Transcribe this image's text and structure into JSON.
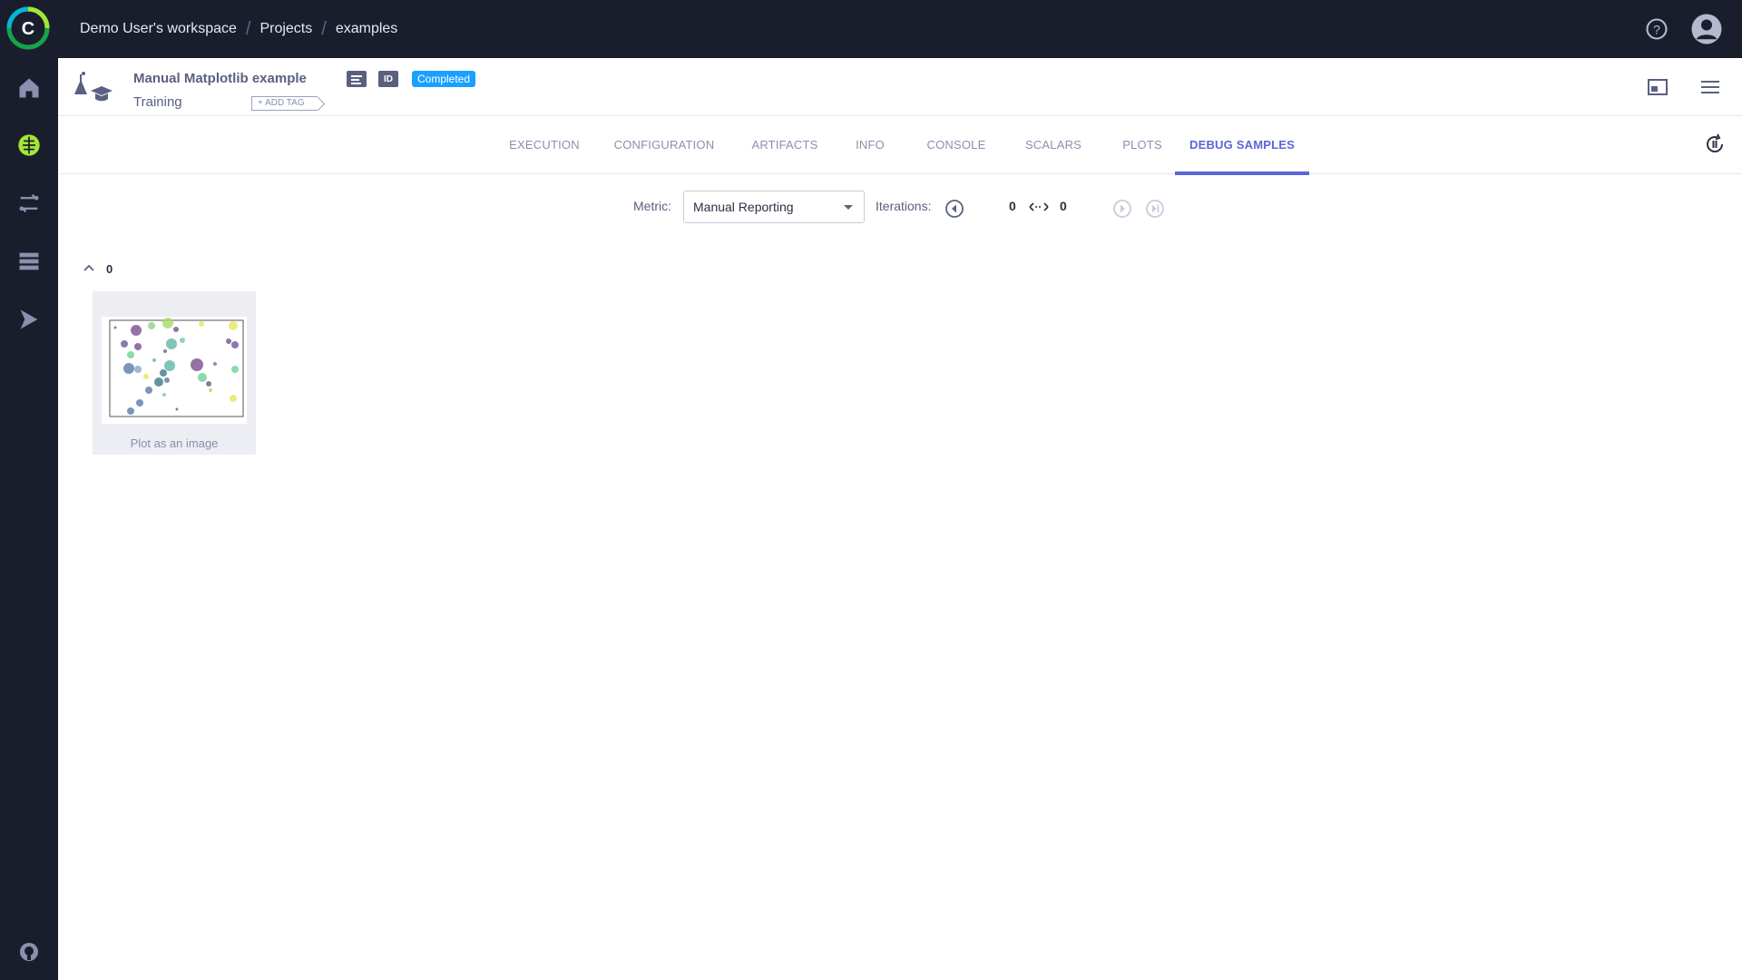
{
  "breadcrumb": {
    "workspace": "Demo User's workspace",
    "projects": "Projects",
    "project": "examples",
    "separator": "/"
  },
  "task": {
    "name": "Manual Matplotlib example",
    "type": "Training",
    "add_tag": "+ ADD TAG",
    "id_label": "ID",
    "status": "Completed"
  },
  "colors": {
    "sidebar": "#1a1e2c",
    "accent": "#5a65d9",
    "status": "#1aa1ff",
    "active_nav": "#a3e635"
  },
  "icons": [
    "logo-icon",
    "home-icon",
    "brain-icon",
    "pipelines-icon",
    "datasets-icon",
    "deploy-icon",
    "github-icon",
    "help-icon",
    "avatar-icon",
    "layout-icon",
    "menu-icon",
    "refresh-icon"
  ],
  "tabs": [
    "EXECUTION",
    "CONFIGURATION",
    "ARTIFACTS",
    "INFO",
    "CONSOLE",
    "SCALARS",
    "PLOTS",
    "DEBUG SAMPLES"
  ],
  "active_tab": "DEBUG SAMPLES",
  "controls": {
    "metric_label": "Metric:",
    "metric_value": "Manual Reporting",
    "iterations_label": "Iterations:",
    "iter_from": "0",
    "iter_to": "0"
  },
  "samples": {
    "group_label": "0",
    "items": [
      {
        "title": "Plot as an image"
      }
    ]
  }
}
